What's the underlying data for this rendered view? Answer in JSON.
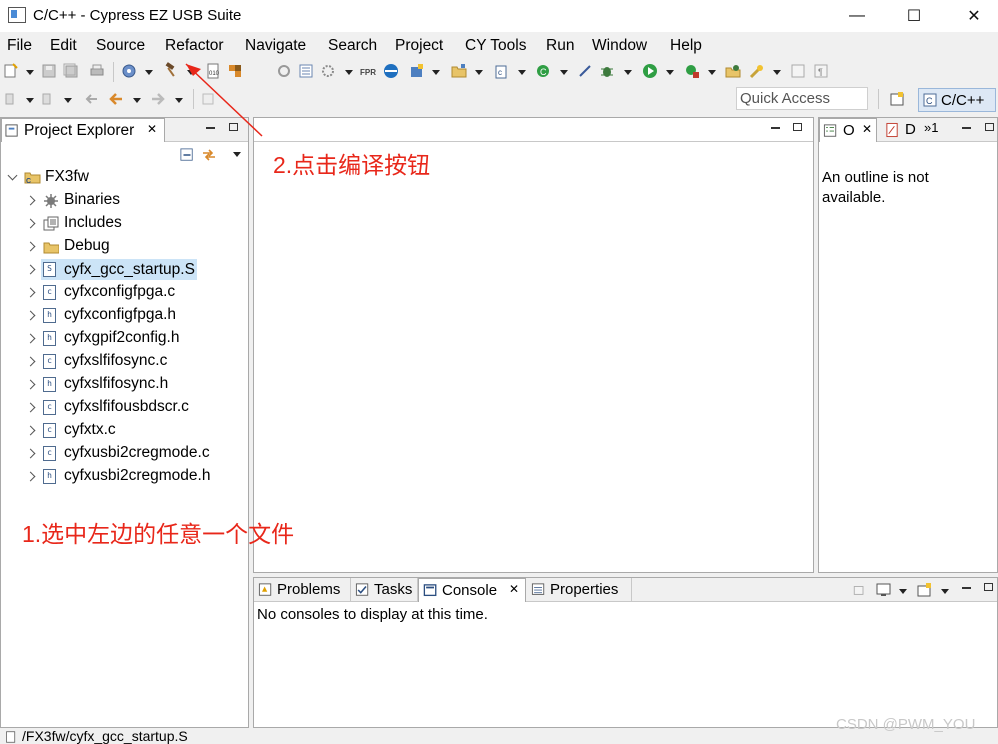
{
  "window": {
    "title": "C/C++ - Cypress EZ USB Suite",
    "minimize_glyph": "—",
    "maximize_glyph": "☐",
    "close_glyph": "✕"
  },
  "menu": [
    "File",
    "Edit",
    "Source",
    "Refactor",
    "Navigate",
    "Search",
    "Project",
    "CY Tools",
    "Run",
    "Window",
    "Help"
  ],
  "toolbar": {
    "quick_access_placeholder": "Quick Access",
    "perspective_label": "C/C++"
  },
  "project_explorer": {
    "tab_label": "Project Explorer",
    "close_glyph": "✕",
    "project": "FX3fw",
    "items": [
      {
        "label": "Binaries",
        "icon": "binaries-icon"
      },
      {
        "label": "Includes",
        "icon": "includes-icon"
      },
      {
        "label": "Debug",
        "icon": "folder-icon"
      },
      {
        "label": "cyfx_gcc_startup.S",
        "icon": "asm-file-icon",
        "glyph": "S",
        "selected": true
      },
      {
        "label": "cyfxconfigfpga.c",
        "icon": "c-file-icon",
        "glyph": "c"
      },
      {
        "label": "cyfxconfigfpga.h",
        "icon": "h-file-icon",
        "glyph": "h"
      },
      {
        "label": "cyfxgpif2config.h",
        "icon": "h-file-icon",
        "glyph": "h"
      },
      {
        "label": "cyfxslfifosync.c",
        "icon": "c-file-icon",
        "glyph": "c"
      },
      {
        "label": "cyfxslfifosync.h",
        "icon": "h-file-icon",
        "glyph": "h"
      },
      {
        "label": "cyfxslfifousbdscr.c",
        "icon": "c-file-icon",
        "glyph": "c"
      },
      {
        "label": "cyfxtx.c",
        "icon": "c-file-icon",
        "glyph": "c"
      },
      {
        "label": "cyfxusbi2cregmode.c",
        "icon": "c-file-icon",
        "glyph": "c"
      },
      {
        "label": "cyfxusbi2cregmode.h",
        "icon": "h-file-icon",
        "glyph": "h"
      }
    ]
  },
  "outline": {
    "tab_o": "O",
    "tab_d": "D",
    "tab_more": "»1",
    "close_glyph": "✕",
    "message": "An outline is not available."
  },
  "bottom_panel": {
    "tabs": [
      "Problems",
      "Tasks",
      "Console",
      "Properties"
    ],
    "active_tab": "Console",
    "close_glyph": "✕",
    "console_message": "No consoles to display at this time."
  },
  "annotations": {
    "step1": "1.选中左边的任意一个文件",
    "step2": "2.点击编译按钮"
  },
  "status_bar": {
    "path": "/FX3fw/cyfx_gcc_startup.S"
  },
  "watermark": "CSDN @PWM_YOU",
  "colors": {
    "annotation_red": "#e8271a",
    "selection_blue": "#cce4f7",
    "perspective_bg": "#dde8f5"
  }
}
